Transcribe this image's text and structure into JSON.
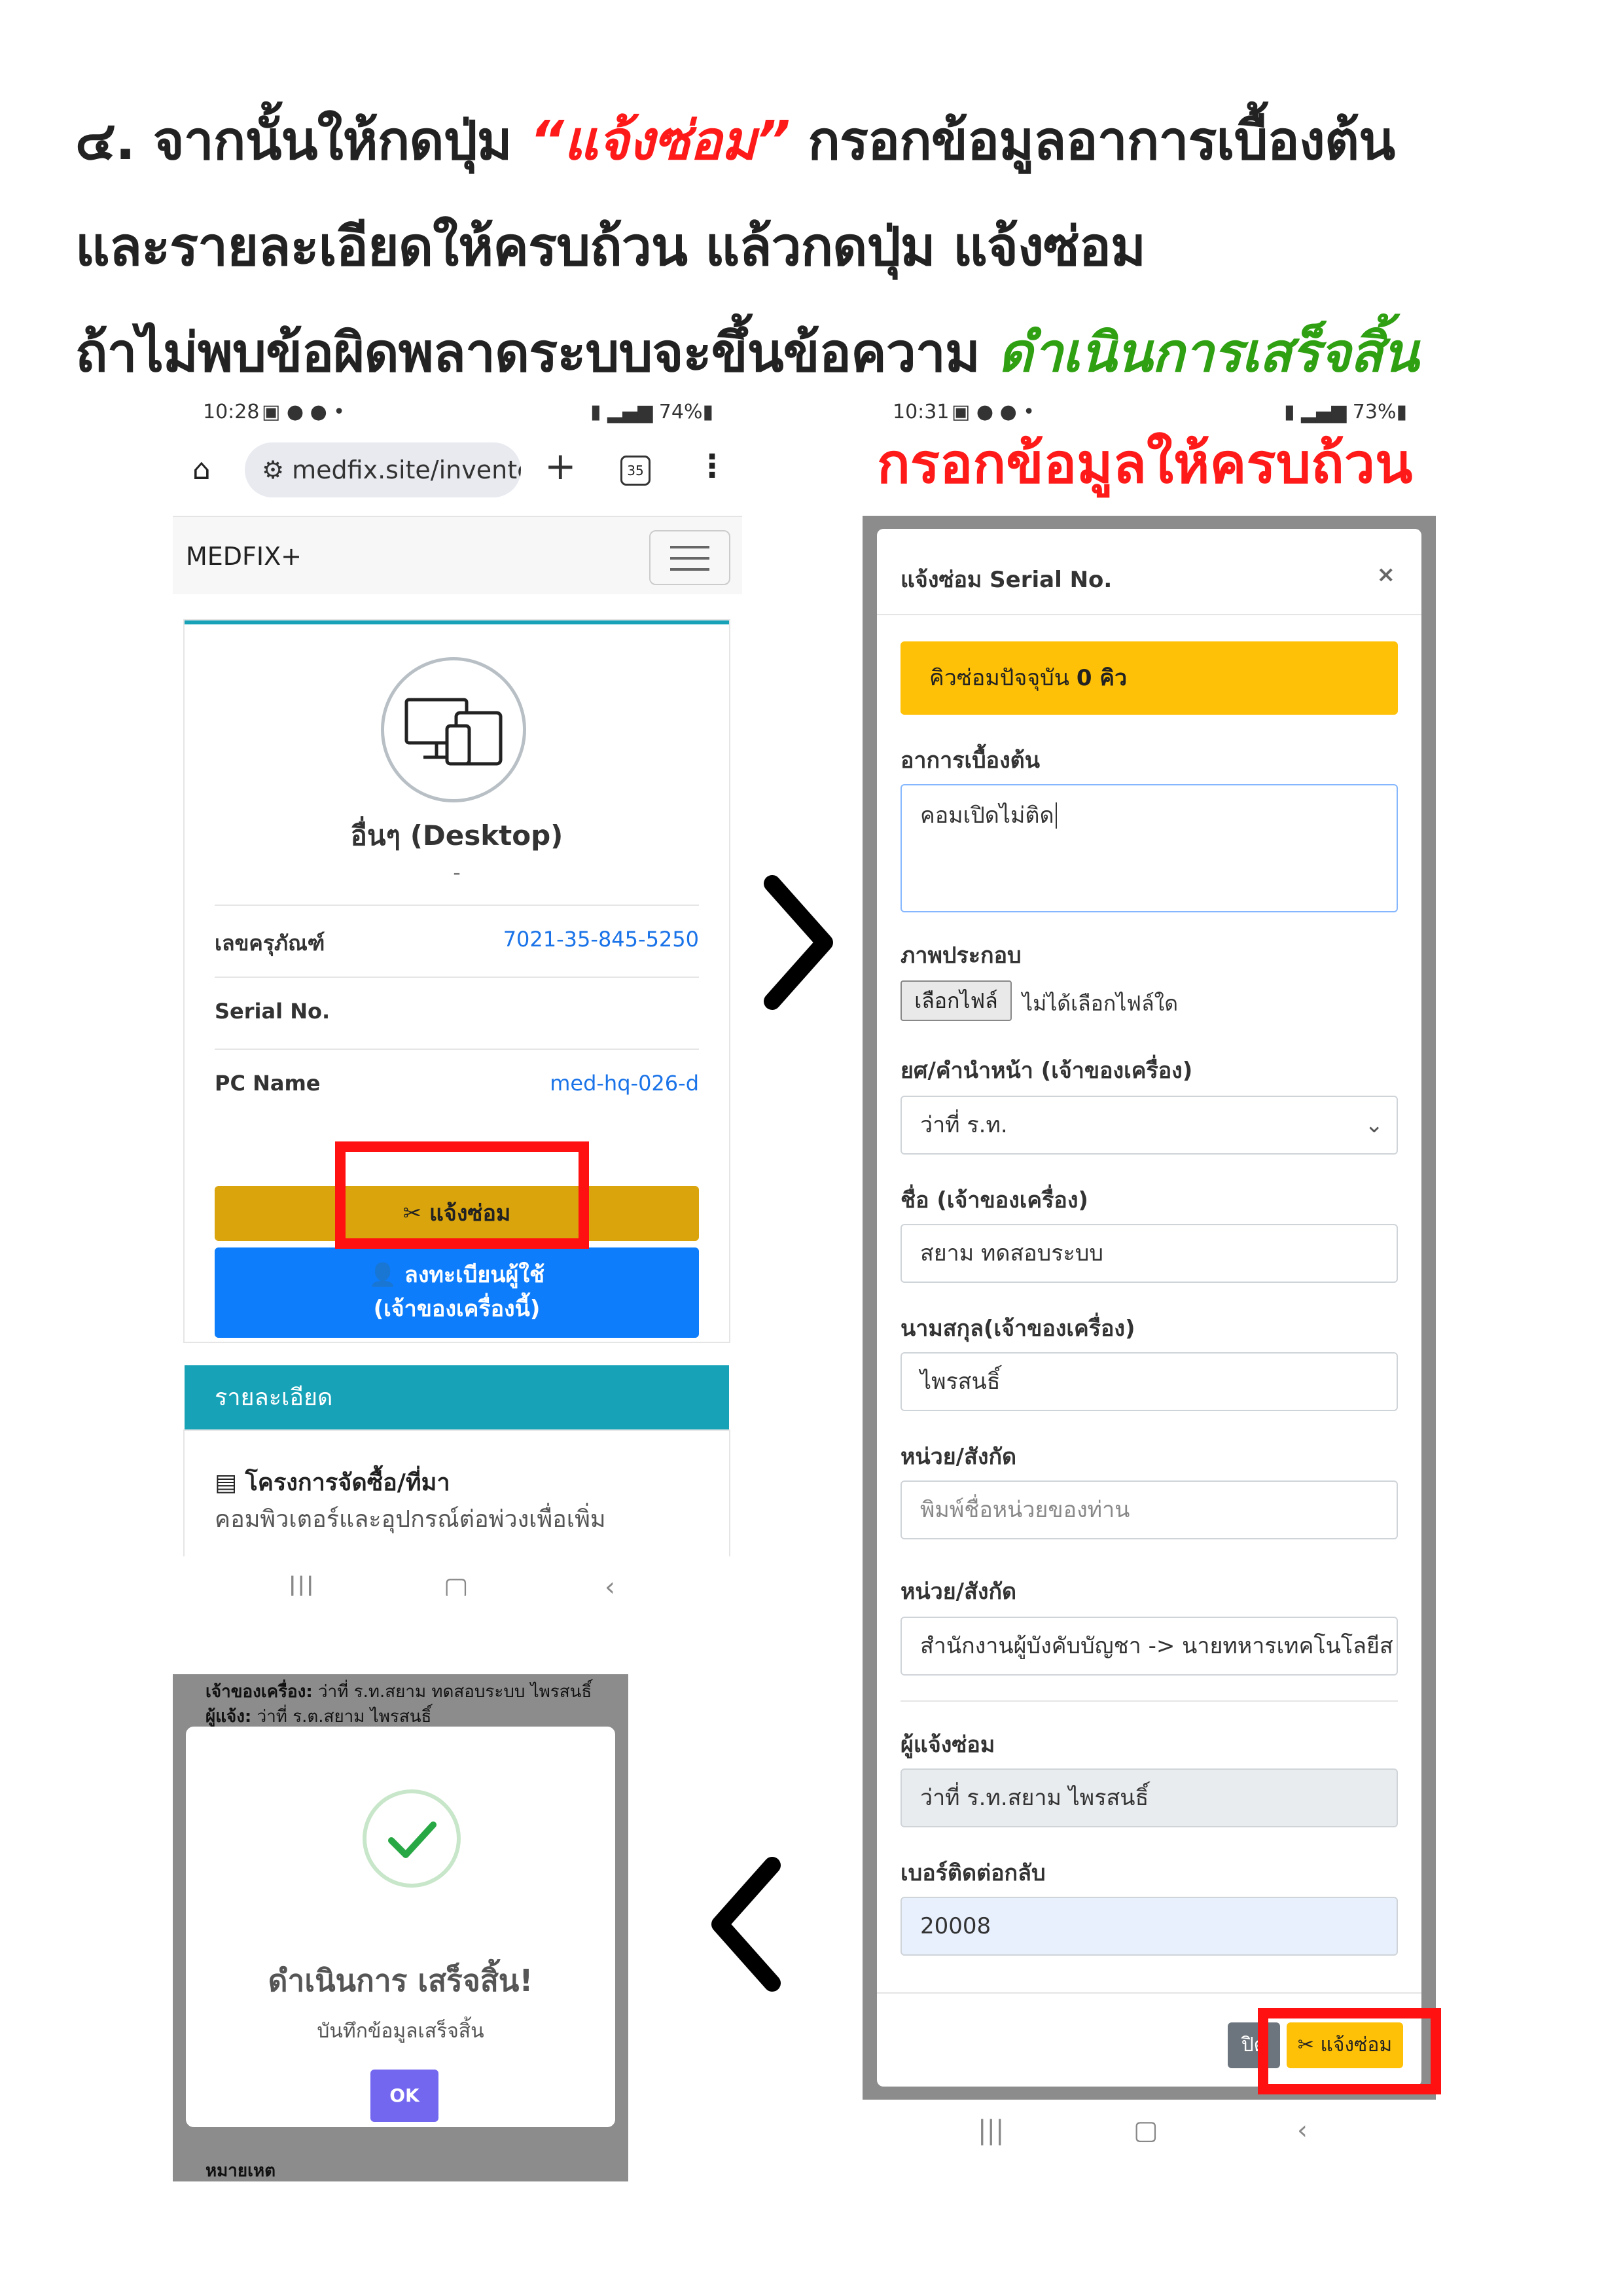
{
  "heading": {
    "prefix": "๔. จากนั้นให้กดปุ่ม ",
    "highlight": "“แจ้งซ่อม”",
    "line1_rest": " กรอกข้อมูลอาการเบื้องต้น",
    "line2": "และรายละเอียดให้ครบถ้วน แล้วกดปุ่ม แจ้งซ่อม",
    "line3_prefix": "ถ้าไม่พบข้อผิดพลาดระบบจะขึ้นข้อความ ",
    "line3_success": "ดำเนินการเสร็จสิ้น",
    "colors": {
      "red": "#ff1a1a",
      "green": "#2fa012"
    }
  },
  "screen1": {
    "status": {
      "time": "10:28",
      "battery": "74%"
    },
    "browser": {
      "url": "medfix.site/inventc",
      "tab_count": "35"
    },
    "navbar": {
      "brand": "MEDFIX+"
    },
    "device": {
      "icon": "desktop-devices-icon",
      "title": "อื่นๆ (Desktop)",
      "subtitle": "-",
      "fields": [
        {
          "label": "เลขครุภัณฑ์",
          "value": "7021-35-845-5250"
        },
        {
          "label": "Serial No.",
          "value": ""
        },
        {
          "label": "PC Name",
          "value": "med-hq-026-d"
        }
      ]
    },
    "buttons": {
      "repair": "แจ้งซ่อม",
      "register_line1": "ลงทะเบียนผู้ใช้",
      "register_line2": "(เจ้าของเครื่องนี้)"
    },
    "details": {
      "header": "รายละเอียด",
      "project_title": "โครงการจัดซื้อ/ที่มา",
      "project_desc": "คอมพิวเตอร์และอุปกรณ์ต่อพ่วงเพื่อเพิ่ม"
    },
    "colors": {
      "teal": "#17a2b8",
      "gold": "#daa40c",
      "blue": "#0d7dfc"
    }
  },
  "screen2": {
    "status": {
      "time": "10:31",
      "battery": "73%"
    },
    "annotation": "กรอกข้อมูลให้ครบถ้วน",
    "modal": {
      "title": "แจ้งซ่อม Serial No.",
      "close": "×",
      "queue_label": "คิวซ่อมปัจจุบัน",
      "queue_value": "0 คิว",
      "symptom_label": "อาการเบื้องต้น",
      "symptom_value": "คอมเปิดไม่ติด",
      "image_label": "ภาพประกอบ",
      "file_button": "เลือกไฟล์",
      "file_status": "ไม่ได้เลือกไฟล์ใด",
      "rank_label": "ยศ/คำนำหน้า (เจ้าของเครื่อง)",
      "rank_value": "ว่าที่ ร.ท.",
      "first_name_label": "ชื่อ (เจ้าของเครื่อง)",
      "first_name_value": "สยาม ทดสอบระบบ",
      "last_name_label": "นามสกุล(เจ้าของเครื่อง)",
      "last_name_value": "ไพรสนธิ์",
      "unit_label_1": "หน่วย/สังกัด",
      "unit_placeholder": "พิมพ์ชื่อหน่วยของท่าน",
      "unit_label_2": "หน่วย/สังกัด",
      "unit_value": "สำนักงานผู้บังคับบัญชา -> นายทหารเทคโนโลยีส",
      "reporter_label": "ผู้แจ้งซ่อม",
      "reporter_value": "ว่าที่ ร.ท.สยาม ไพรสนธิ์",
      "phone_label": "เบอร์ติดต่อกลับ",
      "phone_value": "20008",
      "close_button": "ปิด",
      "submit_button": "แจ้งซ่อม"
    },
    "colors": {
      "yellow": "#ffc107",
      "grey": "#6c757d"
    }
  },
  "screen3": {
    "background_line1_label": "เจ้าของเครื่อง:",
    "background_line1_value": "ว่าที่ ร.ท.สยาม ทดสอบระบบ ไพรสนธิ์",
    "background_line2_label": "ผู้แจ้ง:",
    "background_line2_value": "ว่าที่ ร.ต.สยาม ไพรสนธิ์",
    "background_line3": "หมายเหต",
    "alert": {
      "title": "ดำเนินการ เสร็จสิ้น!",
      "message": "บันทึกข้อมูลเสร็จสิ้น",
      "ok": "OK"
    },
    "colors": {
      "ok": "#7367f0",
      "check": "#28a745"
    }
  }
}
